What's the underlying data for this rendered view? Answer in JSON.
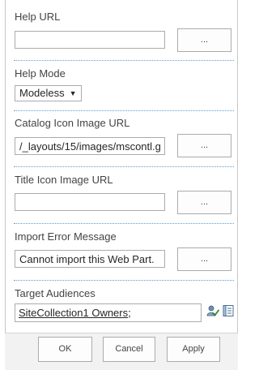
{
  "help_url": {
    "label": "Help URL",
    "value": "",
    "browse_label": "..."
  },
  "help_mode": {
    "label": "Help Mode",
    "selected": "Modeless",
    "arrow": "▼"
  },
  "catalog_icon": {
    "label": "Catalog Icon Image URL",
    "value": "/_layouts/15/images/mscontl.g",
    "browse_label": "..."
  },
  "title_icon": {
    "label": "Title Icon Image URL",
    "value": "",
    "browse_label": "..."
  },
  "import_error": {
    "label": "Import Error Message",
    "value": "Cannot import this Web Part.",
    "browse_label": "..."
  },
  "target_audiences": {
    "label": "Target Audiences",
    "value": "SiteCollection1 Owners",
    "suffix": ";",
    "check_names_icon": "check-names-icon",
    "browse_icon": "address-book-icon"
  },
  "footer": {
    "ok_label": "OK",
    "cancel_label": "Cancel",
    "apply_label": "Apply"
  },
  "colors": {
    "separator": "#5b9bd5",
    "border": "#ababab",
    "text": "#444444",
    "footer_bg": "#f2f2f2"
  }
}
